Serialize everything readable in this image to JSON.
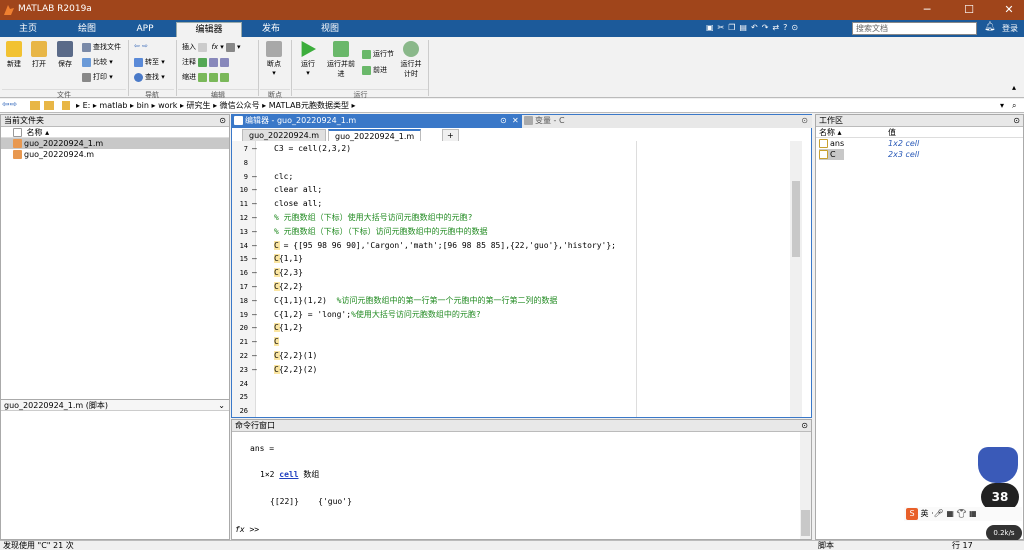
{
  "window": {
    "title": "MATLAB R2019a",
    "minimize": "─",
    "maximize": "☐",
    "close": "✕"
  },
  "ribbon_tabs": [
    "主页",
    "绘图",
    "APP",
    "编辑器",
    "发布",
    "视图"
  ],
  "search": {
    "placeholder": "搜索文档",
    "login": "登录"
  },
  "ribbon": {
    "file": {
      "new": "新建",
      "open": "打开",
      "save": "保存",
      "compare": "查找文件",
      "compare2": "比较",
      "print": "打印",
      "group": "文件"
    },
    "nav": {
      "goto": "转至",
      "find": "查找",
      "group": "导航"
    },
    "edit": {
      "insert": "插入",
      "fx": "fx",
      "comment": "注释",
      "indent": "缩进",
      "group": "编辑"
    },
    "breakpoint": {
      "label": "断点",
      "group": "断点"
    },
    "run": {
      "run": "运行",
      "run_advance": "运行并前进",
      "run_section": "运行节",
      "advance": "前进",
      "run_time": "运行并计时",
      "group": "运行"
    }
  },
  "address": {
    "path": [
      "E:",
      "matlab",
      "bin",
      "work",
      "研究生",
      "微信公众号",
      "MATLAB元胞数据类型"
    ]
  },
  "current_folder": {
    "title": "当前文件夹",
    "column": "名称 ▴",
    "files": [
      "guo_20220924_1.m",
      "guo_20220924.m"
    ],
    "detail": "guo_20220924_1.m (脚本)"
  },
  "editor": {
    "header": "编辑器 - guo_20220924_1.m",
    "var_tab": "变量 - C",
    "tabs": [
      "guo_20220924.m",
      "guo_20220924_1.m"
    ],
    "add_tab": "+",
    "lines": [
      {
        "n": "7",
        "t": "C3 = cell(2,3,2)"
      },
      {
        "n": "8",
        "t": ""
      },
      {
        "n": "9",
        "t": "clc;"
      },
      {
        "n": "10",
        "t": "clear all;"
      },
      {
        "n": "11",
        "t": "close all;"
      },
      {
        "n": "12",
        "t": "% 元胞数组（下标）使用大括号访问元胞数组中的元胞?"
      },
      {
        "n": "13",
        "t": "% 元胞数组（下标）（下标）访问元胞数组中的元胞中的数据"
      },
      {
        "n": "14",
        "t": "C = {[95 98 96 90],'Cargon','math';[96 98 85 85],{22,'guo'},'history'};"
      },
      {
        "n": "15",
        "t": "C{1,1}"
      },
      {
        "n": "16",
        "t": "C{2,3}"
      },
      {
        "n": "17",
        "t": "C{2,2}"
      },
      {
        "n": "18",
        "t": "C{1,1}(1,2)  %访问元胞数组中的第一行第一个元胞中的第一行第二列的数据"
      },
      {
        "n": "19",
        "t": "C{1,2} = 'long';%使用大括号访问元胞数组中的元胞?"
      },
      {
        "n": "20",
        "t": "C{1,2}"
      },
      {
        "n": "21",
        "t": "C"
      },
      {
        "n": "22",
        "t": "C{2,2}(1)"
      },
      {
        "n": "23",
        "t": "C{2,2}(2)"
      },
      {
        "n": "24",
        "t": ""
      },
      {
        "n": "25",
        "t": ""
      },
      {
        "n": "26",
        "t": ""
      }
    ]
  },
  "command": {
    "title": "命令行窗口",
    "l1": "ans =",
    "l2a": "1×2 ",
    "l2b": "cell",
    "l2c": " 数组",
    "l3": "{[22]}    {'guo'}",
    "prompt": "fx >>"
  },
  "workspace": {
    "title": "工作区",
    "col_name": "名称 ▴",
    "col_value": "值",
    "vars": [
      {
        "name": "ans",
        "value": "1x2 cell"
      },
      {
        "name": "C",
        "value": "2x3 cell"
      }
    ]
  },
  "status": {
    "left": "发现使用 \"C\" 21 次",
    "mid": "脚本",
    "row": "行 17"
  },
  "overlay": {
    "battery": "38",
    "speed": "0.2k/s",
    "ime": "英"
  }
}
